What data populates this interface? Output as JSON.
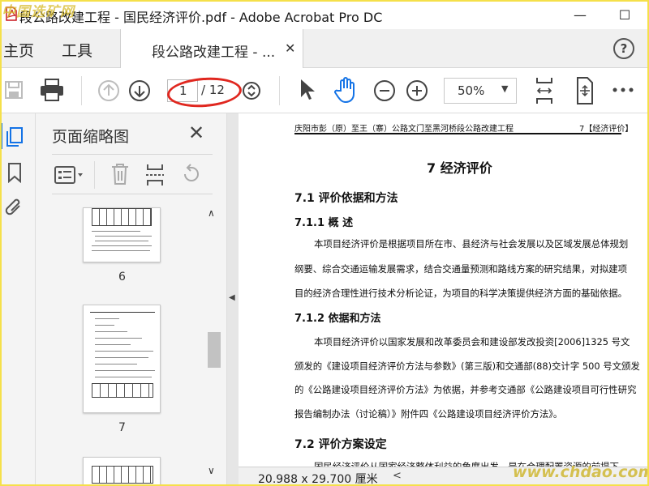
{
  "window": {
    "title": "段公路改建工程 - 国民经济评价.pdf - Adobe Acrobat Pro DC",
    "minimize_glyph": "—",
    "maximize_glyph": "☐"
  },
  "tabs": {
    "home": "主页",
    "tools": "工具",
    "document": "段公路改建工程 - ...",
    "close_glyph": "✕",
    "help_glyph": "?"
  },
  "toolbar": {
    "current_page": "1",
    "total_pages": "/ 12",
    "zoom": "50%",
    "zoom_caret": "▼"
  },
  "thumbnail_panel": {
    "title": "页面缩略图",
    "close_glyph": "✕",
    "pages": [
      "6",
      "7"
    ],
    "scroll_up": "∧",
    "scroll_down": "∨"
  },
  "splitter": {
    "arrow": "◀"
  },
  "document": {
    "header_left": "庆阳市彭（原）至王（寨）公路文门至黑河桥段公路改建工程",
    "header_right": "7【经济评价】",
    "chapter_title": "7 经济评价",
    "section_7_1": "7.1 评价依据和方法",
    "section_7_1_1": "7.1.1 概 述",
    "para1_line1": "本项目经济评价是根据项目所在市、县经济与社会发展以及区域发展总体规划",
    "para1_line2": "纲要、综合交通运输发展需求，结合交通量预测和路线方案的研究结果，对拟建项",
    "para1_line3": "目的经济合理性进行技术分析论证，为项目的科学决策提供经济方面的基础依据。",
    "section_7_1_2": "7.1.2 依据和方法",
    "para2_line1": "本项目经济评价以国家发展和改革委员会和建设部发改投资[2006]1325 号文",
    "para2_line2": "颁发的《建设项目经济评价方法与参数》(第三版)和交通部(88)交计字 500 号文颁发",
    "para2_line3": "的《公路建设项目经济评价方法》为依据，并参考交通部《公路建设项目可行性研究",
    "para2_line4": "报告编制办法（讨论稿）》附件四《公路建设项目经济评价方法》。",
    "section_7_2": "7.2 评价方案设定",
    "para3_line1": "国民经济评价从国家经济整体利益的角度出发，是在合理配置资源的前提下"
  },
  "statusbar": {
    "page_size": "20.988 x 29.700 厘米",
    "nav_left": "<"
  },
  "watermarks": {
    "top_left": "中国选矿网",
    "bottom_right": "www.chdao.com"
  },
  "colors": {
    "accent_blue": "#1473e6",
    "highlight_red": "#e0271f",
    "frame_yellow": "#f5e04a"
  },
  "icons": {
    "app": "acrobat-pdf-icon",
    "save": "save-icon",
    "print": "print-icon",
    "prev_page": "arrow-up-circle-icon",
    "next_page": "arrow-down-circle-icon",
    "page_stepper": "page-stepper-icon",
    "select": "cursor-arrow-icon",
    "hand": "hand-icon",
    "zoom_out": "zoom-out-icon",
    "zoom_in": "zoom-in-icon",
    "fit_page": "fit-page-icon",
    "full_screen": "full-screen-icon",
    "more": "more-icon",
    "thumbnails": "page-thumbnails-icon",
    "bookmarks": "bookmark-icon",
    "attachments": "attachment-icon",
    "options": "options-menu-icon",
    "delete": "trash-icon",
    "extract": "extract-pages-icon",
    "rotate": "rotate-icon"
  }
}
